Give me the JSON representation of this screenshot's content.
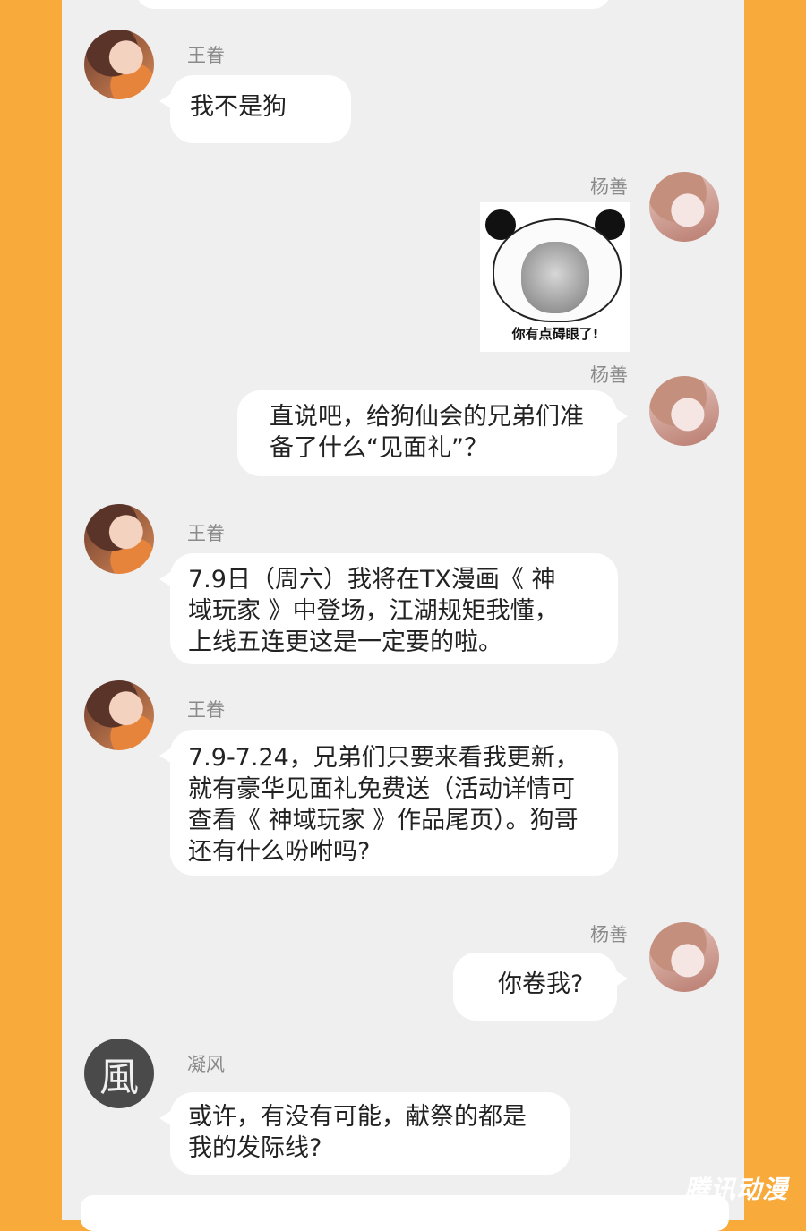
{
  "messages": [
    {
      "sender": "王眷",
      "text": [
        "我不是狗"
      ]
    },
    {
      "sender": "杨善",
      "sticker_caption": "你有点碍眼了!"
    },
    {
      "sender": "杨善",
      "text": [
        "直说吧，给狗仙会的兄弟们准",
        "备了什么“见面礼”？"
      ]
    },
    {
      "sender": "王眷",
      "text": [
        "7.9日（周六）我将在TX漫画《 神",
        "域玩家 》中登场，江湖规矩我懂，",
        "上线五连更这是一定要的啦。"
      ]
    },
    {
      "sender": "王眷",
      "text": [
        "7.9-7.24，兄弟们只要来看我更新，",
        "就有豪华见面礼免费送（活动详情可",
        "查看《 神域玩家 》作品尾页）。狗哥",
        "还有什么吩咐吗?"
      ]
    },
    {
      "sender": "杨善",
      "text": [
        "你卷我?"
      ]
    },
    {
      "sender": "凝风",
      "text": [
        "或许，有没有可能，献祭的都是",
        "我的发际线?"
      ]
    }
  ],
  "avatar_glyph_ningfeng": "風",
  "watermark": "腾讯动漫",
  "colors": {
    "background": "#f8aa3b",
    "panel": "#efefef",
    "bubble": "#ffffff",
    "name": "#8a8a8a"
  }
}
